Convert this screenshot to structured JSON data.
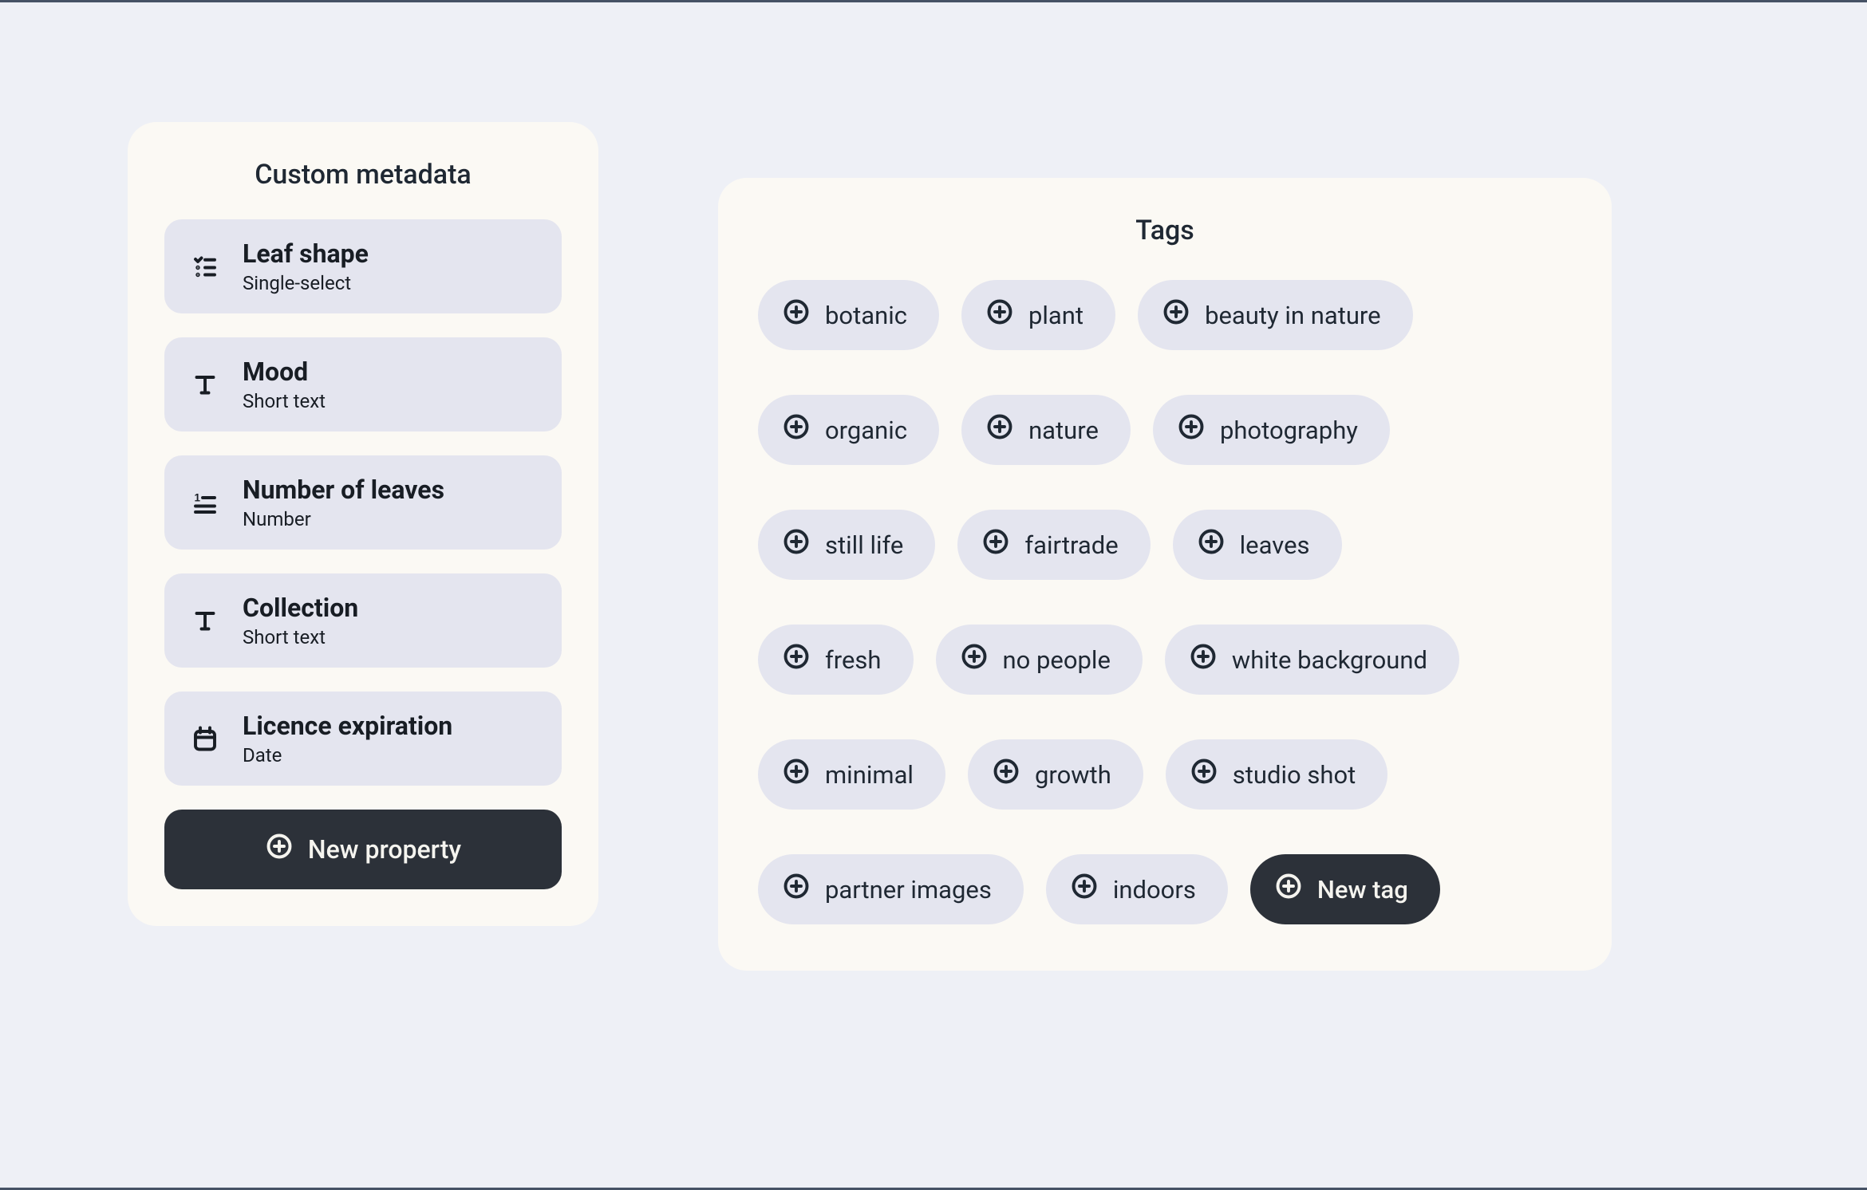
{
  "metadata": {
    "title": "Custom metadata",
    "properties": [
      {
        "icon": "single-select-icon",
        "title": "Leaf shape",
        "subtitle": "Single-select"
      },
      {
        "icon": "text-icon",
        "title": "Mood",
        "subtitle": "Short text"
      },
      {
        "icon": "number-icon",
        "title": "Number of leaves",
        "subtitle": "Number"
      },
      {
        "icon": "text-icon",
        "title": "Collection",
        "subtitle": "Short text"
      },
      {
        "icon": "calendar-icon",
        "title": "Licence expiration",
        "subtitle": "Date"
      }
    ],
    "new_property_label": "New property"
  },
  "tags": {
    "title": "Tags",
    "rows": [
      [
        "botanic",
        "plant",
        "beauty in nature"
      ],
      [
        "organic",
        "nature",
        "photography"
      ],
      [
        "still life",
        "fairtrade",
        "leaves"
      ],
      [
        "fresh",
        "no people",
        "white background"
      ],
      [
        "minimal",
        "growth",
        "studio shot"
      ],
      [
        "partner images",
        "indoors"
      ]
    ],
    "new_tag_label": "New tag"
  }
}
